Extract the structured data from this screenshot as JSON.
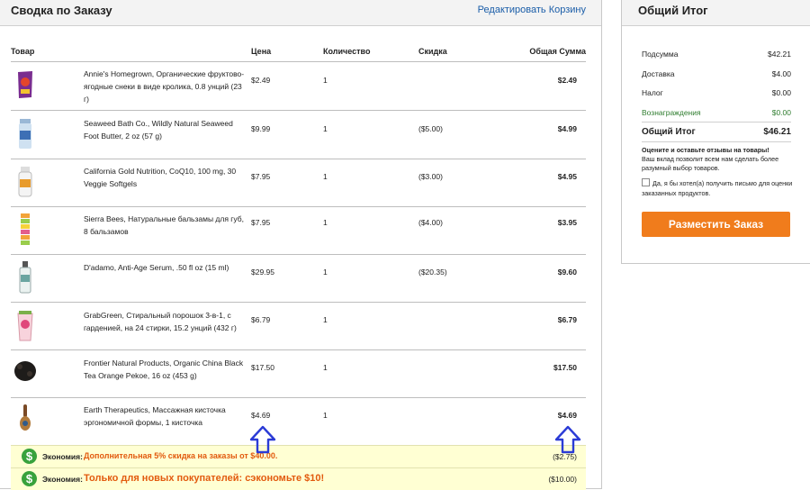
{
  "summary": {
    "title": "Сводка по Заказу",
    "edit_link": "Редактировать Корзину",
    "columns": {
      "product": "Товар",
      "price": "Цена",
      "quantity": "Количество",
      "discount": "Скидка",
      "total": "Общая Сумма"
    },
    "items": [
      {
        "name": "Annie's Homegrown, Органические фруктово-ягодные снеки в виде кролика, 0.8 унций (23 г)",
        "price": "$2.49",
        "qty": "1",
        "discount": "",
        "total": "$2.49",
        "icon": "snack-pouch-icon"
      },
      {
        "name": "Seaweed Bath Co., Wildly Natural Seaweed Foot Butter, 2 oz (57 g)",
        "price": "$9.99",
        "qty": "1",
        "discount": "($5.00)",
        "total": "$4.99",
        "icon": "jar-icon"
      },
      {
        "name": "California Gold Nutrition, CoQ10, 100 mg, 30 Veggie Softgels",
        "price": "$7.95",
        "qty": "1",
        "discount": "($3.00)",
        "total": "$4.95",
        "icon": "pill-bottle-icon"
      },
      {
        "name": "Sierra Bees, Натуральные бальзамы для губ, 8 бальзамов",
        "price": "$7.95",
        "qty": "1",
        "discount": "($4.00)",
        "total": "$3.95",
        "icon": "lip-balm-icon"
      },
      {
        "name": "D'adamo, Anti-Age Serum, .50 fl oz (15 ml)",
        "price": "$29.95",
        "qty": "1",
        "discount": "($20.35)",
        "total": "$9.60",
        "icon": "serum-bottle-icon"
      },
      {
        "name": "GrabGreen, Стиральный порошок 3-в-1, с гарденией, на 24 стирки, 15.2 унций (432 г)",
        "price": "$6.79",
        "qty": "1",
        "discount": "",
        "total": "$6.79",
        "icon": "detergent-tub-icon"
      },
      {
        "name": "Frontier Natural Products, Organic China Black Tea Orange Pekoe, 16 oz (453 g)",
        "price": "$17.50",
        "qty": "1",
        "discount": "",
        "total": "$17.50",
        "icon": "tea-leaves-icon"
      },
      {
        "name": "Earth Therapeutics, Массажная кисточка эргономичной формы, 1 кисточка",
        "price": "$4.69",
        "qty": "1",
        "discount": "",
        "total": "$4.69",
        "icon": "massage-brush-icon"
      }
    ],
    "savings": [
      {
        "label": "Экономия:",
        "text": "Дополнительная 5% скидка на заказы от $40.00.",
        "amount": "($2.75)"
      },
      {
        "label": "Экономия:",
        "text": "Только для новых покупателей: сэкономьте $10!",
        "amount": "($10.00)"
      }
    ],
    "savings_icon": "$"
  },
  "totals": {
    "title": "Общий Итог",
    "subtotal_label": "Подсумма",
    "subtotal": "$42.21",
    "shipping_label": "Доставка",
    "shipping": "$4.00",
    "tax_label": "Налог",
    "tax": "$0.00",
    "rewards_label": "Вознаграждения",
    "rewards": "$0.00",
    "grand_label": "Общий Итог",
    "grand": "$46.21",
    "review_bold": "Оцените и оставьте отзывы на товары!",
    "review_body": "Ваш вклад позволит всем нам сделать более разумный выбор товаров.",
    "email_opt": "Да, я бы хотел(а) получить письмо для оценки заказанных продуктов.",
    "place_order": "Разместить Заказ"
  },
  "colors": {
    "accent_orange": "#f07c1c",
    "link_blue": "#1a5da8",
    "savings_bg": "#ffffd3",
    "reward_green": "#2f7d2f"
  }
}
